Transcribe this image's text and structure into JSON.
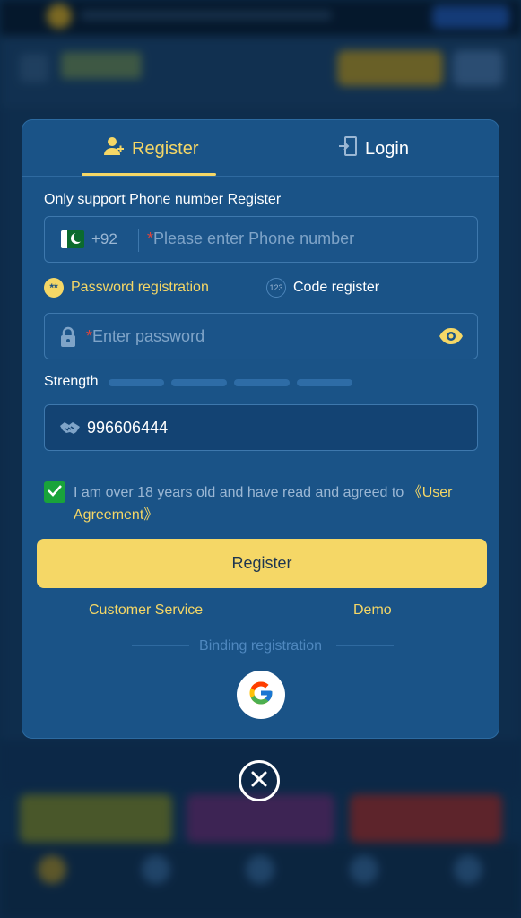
{
  "tabs": {
    "register": "Register",
    "login": "Login"
  },
  "form": {
    "support_label": "Only support Phone number Register",
    "country_code": "+92",
    "required_mark": "*",
    "phone_placeholder": "Please enter Phone number",
    "mode_password": "Password registration",
    "mode_code": "Code register",
    "password_placeholder": "Enter password",
    "strength_label": "Strength",
    "invite_code": "996606444",
    "agree_text": "I am over 18 years old and have read and agreed to ",
    "agree_link": "《User Agreement》",
    "register_button": "Register",
    "customer_service": "Customer Service",
    "demo": "Demo",
    "binding_label": "Binding registration"
  },
  "colors": {
    "accent": "#f5d766",
    "modal_bg": "#1a5387",
    "check_green": "#19a33a"
  },
  "icons": [
    "user-plus-icon",
    "login-icon",
    "pakistan-flag-icon",
    "lock-icon",
    "eye-icon",
    "handshake-icon",
    "checkbox-check-icon",
    "google-icon",
    "close-icon"
  ]
}
